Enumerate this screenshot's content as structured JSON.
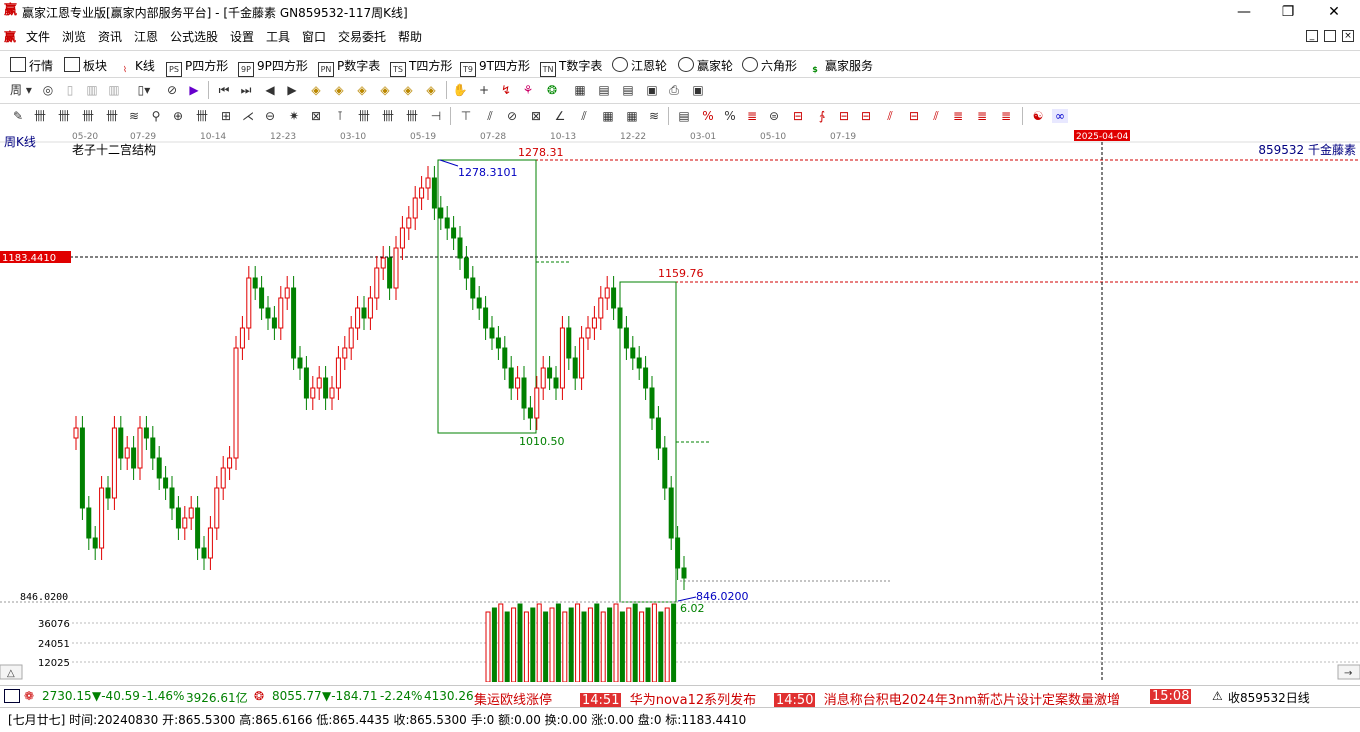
{
  "window": {
    "title": "赢家江恩专业版[赢家内部服务平台] - [千金藤素   GN859532-117周K线]",
    "controls": [
      "—",
      "❐",
      "✕"
    ]
  },
  "menu": [
    "文件",
    "浏览",
    "资讯",
    "江恩",
    "公式选股",
    "设置",
    "工具",
    "窗口",
    "交易委托",
    "帮助"
  ],
  "toolbar1": [
    {
      "label": "行情",
      "icon": "grid-icon"
    },
    {
      "label": "板块",
      "icon": "blocks-icon"
    },
    {
      "label": "K线",
      "icon": "kline-icon"
    },
    {
      "label": "P四方形",
      "icon": "ps-icon",
      "tag": "PS"
    },
    {
      "label": "9P四方形",
      "icon": "9p-icon",
      "tag": "9P"
    },
    {
      "label": "P数字表",
      "icon": "pn-icon",
      "tag": "PN"
    },
    {
      "label": "T四方形",
      "icon": "ts-icon",
      "tag": "TS"
    },
    {
      "label": "9T四方形",
      "icon": "9t-icon",
      "tag": "T9"
    },
    {
      "label": "T数字表",
      "icon": "tn-icon",
      "tag": "TN"
    },
    {
      "label": "江恩轮",
      "icon": "gann-wheel-icon"
    },
    {
      "label": "赢家轮",
      "icon": "winner-wheel-icon"
    },
    {
      "label": "六角形",
      "icon": "hexagon-icon"
    },
    {
      "label": "赢家服务",
      "icon": "dollar-icon"
    }
  ],
  "toolbar2_first": "周",
  "chart": {
    "period_label": "周K线",
    "indicator_name": "老子十二宫结构",
    "stock_label": "859532  千金藤素",
    "date_marker": "2025-04-04",
    "date_ticks": [
      "05-20",
      "07-29",
      "10-14",
      "12-23",
      "03-10",
      "05-19",
      "07-28",
      "10-13",
      "12-22",
      "03-01",
      "05-10",
      "07-19"
    ],
    "crosshair_price": "1183.4410",
    "annotations": {
      "high1": "1278.31",
      "high1_detail": "1278.3101",
      "low1": "1010.50",
      "high2": "1159.76",
      "low2": "846.0200",
      "low2_left": "846.0200",
      "low2_partial": "6.02"
    },
    "volume_ticks": [
      "36076",
      "24051",
      "12025"
    ],
    "colors": {
      "up": "#e00000",
      "down": "#008000",
      "box": "#008000",
      "dotted": "#d00000",
      "annot": "#0000c0"
    }
  },
  "status1": {
    "idx1": "2730.15",
    "idx1_chg": "▼-40.59",
    "idx1_pct": "-1.46%",
    "idx1_amt": "3926.61亿",
    "idx2": "8055.77",
    "idx2_chg": "▼-184.71",
    "idx2_pct": "-2.24%",
    "idx2_amt": "4130.26",
    "news": [
      {
        "time": "",
        "text": "集运欧线涨停"
      },
      {
        "time": "14:51",
        "text": "华为nova12系列发布"
      },
      {
        "time": "14:50",
        "text": "消息称台积电2024年3nm新芯片设计定案数量激增"
      },
      {
        "time": "15:08",
        "text": ""
      }
    ],
    "right": "收859532日线"
  },
  "status2": "[七月廿七] 时间:20240830 开:865.5300 高:865.6166 低:865.4435 收:865.5300 手:0 额:0.00 换:0.00 涨:0.00 盘:0 标:1183.4410"
}
